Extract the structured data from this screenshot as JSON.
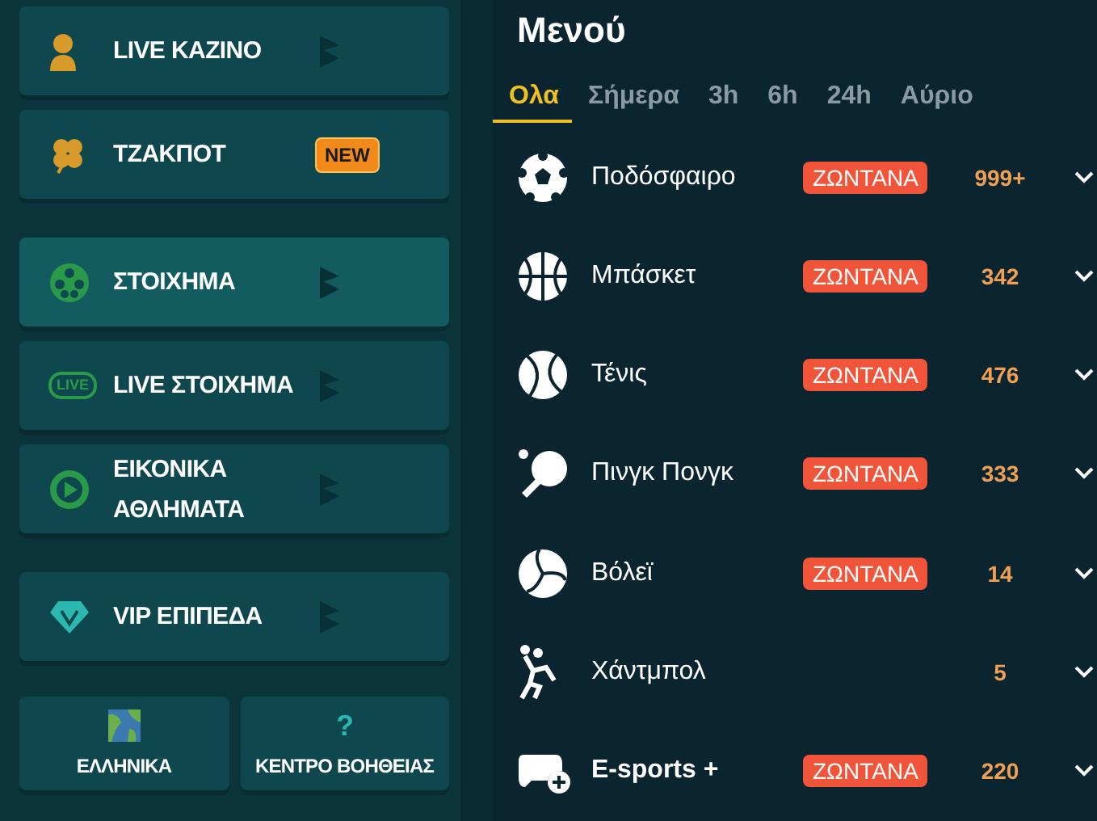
{
  "sidebar": {
    "groups": [
      {
        "items": [
          {
            "label": "LIVE KAZINO",
            "selected": false
          },
          {
            "label": "ΤΖΑΚΠΟΤ",
            "selected": false,
            "badge": "NEW"
          }
        ]
      },
      {
        "items": [
          {
            "label": "ΣΤΟΙΧΗΜΑ",
            "selected": true
          },
          {
            "label": "LIVE ΣΤΟΙΧΗΜΑ",
            "selected": false,
            "icon_text": "LIVE"
          },
          {
            "label": "ΕΙΚΟΝΙΚΑ ΑΘΛΗΜΑΤΑ",
            "selected": false
          }
        ]
      },
      {
        "items": [
          {
            "label": "VIP ΕΠΙΠΕΔΑ",
            "selected": false
          }
        ]
      }
    ],
    "bottom_buttons": [
      {
        "label": "ΕΛΛΗΝΙΚΑ"
      },
      {
        "label": "ΚΕΝΤΡΟ ΒΟΗΘΕΙΑΣ",
        "icon": "?"
      }
    ]
  },
  "menu": {
    "title": "Μενού",
    "tabs": [
      {
        "label": "Ολα",
        "selected": true
      },
      {
        "label": "Σήμερα",
        "selected": false
      },
      {
        "label": "3h",
        "selected": false
      },
      {
        "label": "6h",
        "selected": false
      },
      {
        "label": "24h",
        "selected": false
      },
      {
        "label": "Αύριο",
        "selected": false
      }
    ],
    "sports": [
      {
        "name": "Ποδόσφαιρο",
        "bold": false,
        "live": "ΖΩΝΤΑΝΑ",
        "count": "999+"
      },
      {
        "name": "Μπάσκετ",
        "bold": false,
        "live": "ΖΩΝΤΑΝΑ",
        "count": "342"
      },
      {
        "name": "Τένις",
        "bold": false,
        "live": "ΖΩΝΤΑΝΑ",
        "count": "476"
      },
      {
        "name": "Πινγκ Πονγκ",
        "bold": false,
        "live": "ΖΩΝΤΑΝΑ",
        "count": "333"
      },
      {
        "name": "Βόλεϊ",
        "bold": false,
        "live": "ΖΩΝΤΑΝΑ",
        "count": "14"
      },
      {
        "name": "Χάντμπολ",
        "bold": false,
        "count": "5"
      },
      {
        "name": "E-sports +",
        "bold": true,
        "live": "ΖΩΝΤΑΝΑ",
        "count": "220"
      }
    ]
  }
}
